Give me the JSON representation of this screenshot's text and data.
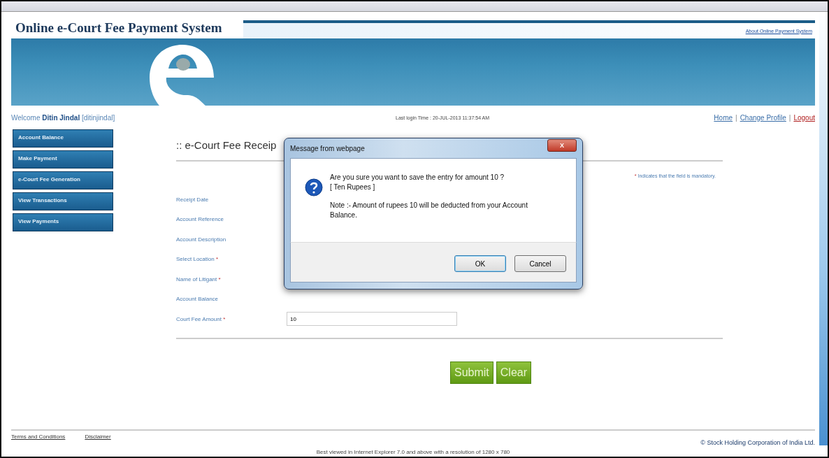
{
  "header": {
    "title": "Online e-Court Fee Payment System",
    "about_link": "About Online Payment System"
  },
  "user_bar": {
    "welcome": "Welcome",
    "user_name": "Ditin Jindal",
    "user_id": "[ditinjindal]",
    "last_login": "Last login Time : 20-JUL-2013 11:37:54 AM",
    "separator": "|",
    "links": [
      {
        "label": "Home",
        "kind": "link"
      },
      {
        "label": "Change Profile",
        "kind": "link"
      },
      {
        "label": "Logout",
        "kind": "logout"
      }
    ]
  },
  "sidebar": {
    "items": [
      {
        "label": "Account Balance"
      },
      {
        "label": "Make Payment"
      },
      {
        "label": "e-Court Fee Generation"
      },
      {
        "label": "View Transactions"
      },
      {
        "label": "View Payments"
      }
    ]
  },
  "form": {
    "title": ":: e-Court Fee Receip",
    "mandatory_mark": "*",
    "mandatory_note": "Indicates that the field is mandatory.",
    "fields": [
      {
        "label": "Receipt Date"
      },
      {
        "label": "Account Reference"
      },
      {
        "label": "Account Description"
      },
      {
        "label": "Select Location",
        "mark": "*"
      },
      {
        "label": "Name of Litigant",
        "mark": "*"
      },
      {
        "label": "Account Balance"
      },
      {
        "label": "Court Fee Amount",
        "mark": "*",
        "value": "10"
      }
    ],
    "buttons": [
      "Submit",
      "Clear"
    ]
  },
  "dialog": {
    "title": "Message from webpage",
    "close": "X",
    "question": "Are you sure you want to save the entry for amount 10  ?",
    "amount_words": "[ Ten Rupees ]",
    "note": "Note :- Amount of rupees 10 will be deducted from your Account Balance.",
    "buttons": [
      {
        "label": "OK",
        "selected": true
      },
      {
        "label": "Cancel",
        "selected": false
      }
    ]
  },
  "footer": {
    "links": [
      "Terms and Conditions",
      "Disclaimer"
    ],
    "copyright": "© Stock Holding Corporation of India Ltd.",
    "best_viewed": "Best viewed in Internet Explorer 7.0 and above with a resolution of 1280 x 780"
  }
}
